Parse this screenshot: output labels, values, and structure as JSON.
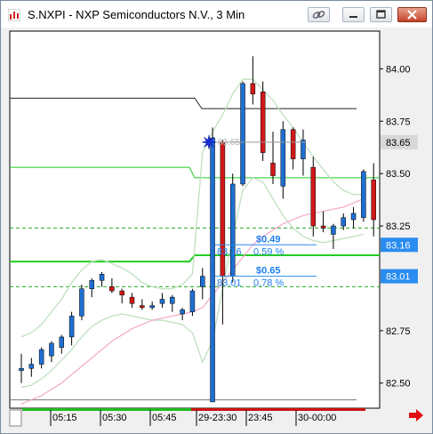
{
  "window": {
    "title": "S.NXPI - NXP Semiconductors N.V., 3 Min"
  },
  "colors": {
    "up": "#1f6fd1",
    "down": "#d01818",
    "bb_band": "#bfe0bf",
    "ma": "#f4a8c8",
    "level_solid": "#22cc22",
    "level_dashed": "#22aa22",
    "label_bg": "#2a8cf0",
    "current_bg": "#d8d8d8"
  },
  "chart_data": {
    "type": "candlestick",
    "symbol": "S.NXPI",
    "interval": "3 Min",
    "ylim": [
      82.38,
      84.18
    ],
    "y_ticks": [
      "84.00",
      "83.75",
      "83.50",
      "83.25",
      "82.75",
      "82.50"
    ],
    "x_ticks": [
      "05:15",
      "05:30",
      "05:45",
      "29-23:30",
      "23:45",
      "30-00:00"
    ],
    "price_markers": [
      {
        "label": "83.65",
        "kind": "current",
        "value": 83.65
      },
      {
        "label": "83.16",
        "kind": "level",
        "value": 83.16
      },
      {
        "label": "83.01",
        "kind": "level",
        "value": 83.01
      }
    ],
    "candles": [
      {
        "o": 82.56,
        "h": 82.64,
        "l": 82.5,
        "c": 82.57
      },
      {
        "o": 82.57,
        "h": 82.62,
        "l": 82.53,
        "c": 82.59
      },
      {
        "o": 82.59,
        "h": 82.67,
        "l": 82.57,
        "c": 82.66
      },
      {
        "o": 82.63,
        "h": 82.7,
        "l": 82.6,
        "c": 82.69
      },
      {
        "o": 82.67,
        "h": 82.73,
        "l": 82.64,
        "c": 82.72
      },
      {
        "o": 82.72,
        "h": 82.84,
        "l": 82.68,
        "c": 82.82
      },
      {
        "o": 82.82,
        "h": 82.97,
        "l": 82.8,
        "c": 82.95
      },
      {
        "o": 82.95,
        "h": 83.0,
        "l": 82.91,
        "c": 82.99
      },
      {
        "o": 82.99,
        "h": 83.03,
        "l": 82.96,
        "c": 83.02
      },
      {
        "o": 82.96,
        "h": 83.0,
        "l": 82.93,
        "c": 82.94
      },
      {
        "o": 82.94,
        "h": 82.95,
        "l": 82.88,
        "c": 82.92
      },
      {
        "o": 82.91,
        "h": 82.93,
        "l": 82.86,
        "c": 82.88
      },
      {
        "o": 82.87,
        "h": 82.9,
        "l": 82.85,
        "c": 82.86
      },
      {
        "o": 82.86,
        "h": 82.89,
        "l": 82.85,
        "c": 82.87
      },
      {
        "o": 82.88,
        "h": 82.93,
        "l": 82.86,
        "c": 82.9
      },
      {
        "o": 82.88,
        "h": 82.92,
        "l": 82.84,
        "c": 82.91
      },
      {
        "o": 82.83,
        "h": 82.86,
        "l": 82.8,
        "c": 82.85
      },
      {
        "o": 82.84,
        "h": 82.95,
        "l": 82.82,
        "c": 82.94
      },
      {
        "o": 82.96,
        "h": 83.05,
        "l": 82.9,
        "c": 83.01
      },
      {
        "o": 82.41,
        "h": 83.72,
        "l": 82.41,
        "c": 83.67
      },
      {
        "o": 83.65,
        "h": 83.66,
        "l": 82.78,
        "c": 83.01
      },
      {
        "o": 83.01,
        "h": 83.5,
        "l": 82.98,
        "c": 83.45
      },
      {
        "o": 83.45,
        "h": 83.94,
        "l": 83.44,
        "c": 83.93
      },
      {
        "o": 83.93,
        "h": 84.06,
        "l": 83.83,
        "c": 83.88
      },
      {
        "o": 83.89,
        "h": 83.94,
        "l": 83.56,
        "c": 83.6
      },
      {
        "o": 83.55,
        "h": 83.7,
        "l": 83.45,
        "c": 83.49
      },
      {
        "o": 83.44,
        "h": 83.75,
        "l": 83.38,
        "c": 83.71
      },
      {
        "o": 83.71,
        "h": 83.72,
        "l": 83.52,
        "c": 83.57
      },
      {
        "o": 83.57,
        "h": 83.71,
        "l": 83.49,
        "c": 83.66
      },
      {
        "o": 83.53,
        "h": 83.58,
        "l": 83.2,
        "c": 83.25
      },
      {
        "o": 83.25,
        "h": 83.32,
        "l": 83.22,
        "c": 83.24
      },
      {
        "o": 83.21,
        "h": 83.26,
        "l": 83.14,
        "c": 83.25
      },
      {
        "o": 83.25,
        "h": 83.31,
        "l": 83.23,
        "c": 83.29
      },
      {
        "o": 83.28,
        "h": 83.34,
        "l": 83.24,
        "c": 83.31
      },
      {
        "o": 83.29,
        "h": 83.52,
        "l": 83.27,
        "c": 83.51
      },
      {
        "o": 83.47,
        "h": 83.55,
        "l": 83.2,
        "c": 83.28
      }
    ],
    "bollinger_upper": [
      82.72,
      82.74,
      82.78,
      82.84,
      82.9,
      82.98,
      83.04,
      83.08,
      83.09,
      83.07,
      83.05,
      83.02,
      82.98,
      82.96,
      82.95,
      82.95,
      82.97,
      83.02,
      83.6,
      83.7,
      83.78,
      83.88,
      83.95,
      83.95,
      83.9,
      83.85,
      83.78,
      83.72,
      83.65,
      83.58,
      83.52,
      83.46,
      83.42,
      83.4,
      83.4
    ],
    "bollinger_lower": [
      82.48,
      82.49,
      82.52,
      82.56,
      82.61,
      82.66,
      82.72,
      82.77,
      82.8,
      82.82,
      82.83,
      82.82,
      82.81,
      82.8,
      82.8,
      82.79,
      82.78,
      82.74,
      82.6,
      82.7,
      82.95,
      83.2,
      83.42,
      83.48,
      83.46,
      83.38,
      83.3,
      83.24,
      83.2,
      83.18,
      83.17,
      83.18,
      83.19,
      83.2,
      83.21
    ],
    "moving_average": [
      82.4,
      82.42,
      82.44,
      82.47,
      82.5,
      82.54,
      82.58,
      82.62,
      82.66,
      82.7,
      82.73,
      82.76,
      82.78,
      82.8,
      82.81,
      82.82,
      82.83,
      82.84,
      82.86,
      82.92,
      82.98,
      83.04,
      83.1,
      83.16,
      83.2,
      83.23,
      83.26,
      83.28,
      83.3,
      83.31,
      83.32,
      83.33,
      83.34,
      83.36,
      83.38
    ],
    "levels": [
      {
        "name": "upper_line",
        "style": "dark",
        "value_left": 83.86,
        "value_right": 83.81
      },
      {
        "name": "level_1",
        "style": "solid",
        "value_left": 83.53,
        "value_right": 83.48
      },
      {
        "name": "level_2",
        "style": "dashed",
        "value": 83.24
      },
      {
        "name": "level_3",
        "style": "solid",
        "value_left": 83.08,
        "value_right": 83.11
      },
      {
        "name": "level_4",
        "style": "dashed",
        "value": 82.96
      },
      {
        "name": "base_line",
        "style": "gray",
        "value": 82.42
      }
    ],
    "annotations": [
      {
        "id": "gain_1",
        "dollar": "$0.49",
        "price": "83.16",
        "pct": "0.59 %"
      },
      {
        "id": "gain_2",
        "dollar": "$0.65",
        "price": "83.01",
        "pct": "0.78 %"
      }
    ],
    "marker_label": "83.65"
  }
}
